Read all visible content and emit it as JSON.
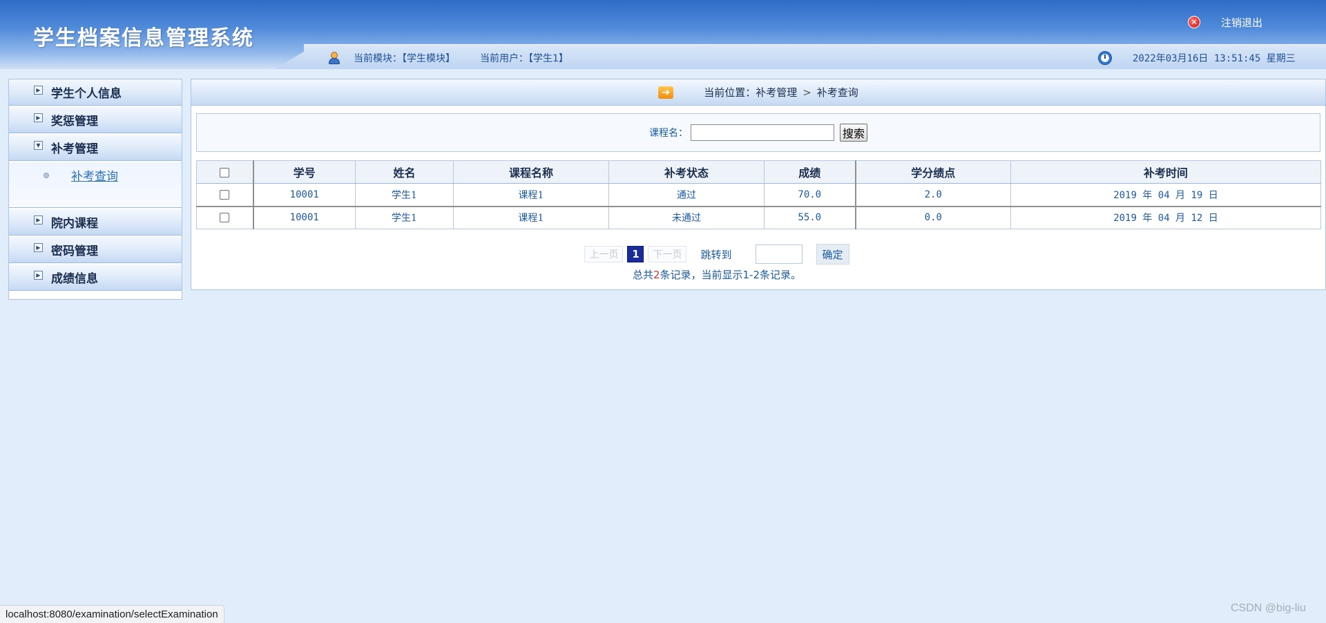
{
  "header": {
    "title": "学生档案信息管理系统",
    "logout_label": "注销退出",
    "module_text": "当前模块：【学生模块】",
    "user_text": "当前用户：【学生1】",
    "datetime": "2022年03月16日 13:51:45 星期三"
  },
  "sidebar": {
    "items": [
      {
        "label": "学生个人信息"
      },
      {
        "label": "奖惩管理"
      },
      {
        "label": "补考管理",
        "sub": "补考查询"
      },
      {
        "label": "院内课程"
      },
      {
        "label": "密码管理"
      },
      {
        "label": "成绩信息"
      }
    ]
  },
  "breadcrumb": {
    "prefix": "当前位置：",
    "part1": "补考管理",
    "sep": ">",
    "part2": "补考查询"
  },
  "search": {
    "label": "课程名：",
    "value": "",
    "button": "搜索"
  },
  "table": {
    "columns": [
      "学号",
      "姓名",
      "课程名称",
      "补考状态",
      "成绩",
      "学分绩点",
      "补考时间"
    ],
    "rows": [
      [
        "10001",
        "学生1",
        "课程1",
        "通过",
        "70.0",
        "2.0",
        "2019 年 04 月 19 日"
      ],
      [
        "10001",
        "学生1",
        "课程1",
        "未通过",
        "55.0",
        "0.0",
        "2019 年 04 月 12 日"
      ]
    ]
  },
  "pager": {
    "prev": "上一页",
    "current": "1",
    "next": "下一页",
    "jump_label": "跳转到",
    "jump_value": "",
    "confirm": "确定",
    "summary_a": "总共",
    "summary_count": "2",
    "summary_b": "条记录，当前显示1-2条记录。"
  },
  "status": {
    "url": "localhost:8080/examination/selectExamination"
  },
  "watermark": "CSDN @big-liu"
}
